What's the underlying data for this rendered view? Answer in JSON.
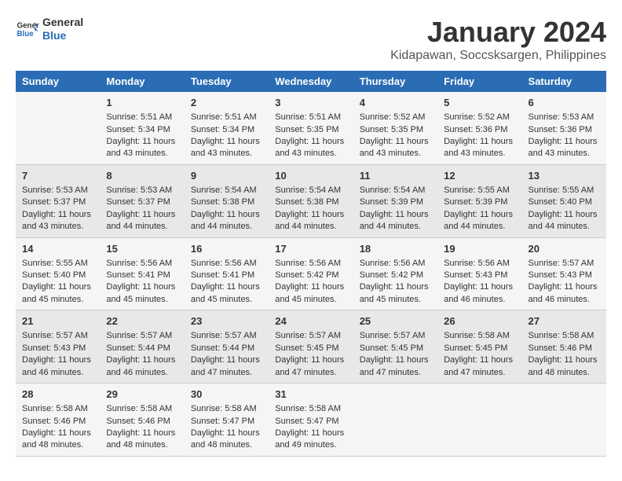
{
  "header": {
    "logo_line1": "General",
    "logo_line2": "Blue",
    "main_title": "January 2024",
    "subtitle": "Kidapawan, Soccsksargen, Philippines"
  },
  "calendar": {
    "days_of_week": [
      "Sunday",
      "Monday",
      "Tuesday",
      "Wednesday",
      "Thursday",
      "Friday",
      "Saturday"
    ],
    "weeks": [
      [
        {
          "day": "",
          "sunrise": "",
          "sunset": "",
          "daylight": ""
        },
        {
          "day": "1",
          "sunrise": "Sunrise: 5:51 AM",
          "sunset": "Sunset: 5:34 PM",
          "daylight": "Daylight: 11 hours and 43 minutes."
        },
        {
          "day": "2",
          "sunrise": "Sunrise: 5:51 AM",
          "sunset": "Sunset: 5:34 PM",
          "daylight": "Daylight: 11 hours and 43 minutes."
        },
        {
          "day": "3",
          "sunrise": "Sunrise: 5:51 AM",
          "sunset": "Sunset: 5:35 PM",
          "daylight": "Daylight: 11 hours and 43 minutes."
        },
        {
          "day": "4",
          "sunrise": "Sunrise: 5:52 AM",
          "sunset": "Sunset: 5:35 PM",
          "daylight": "Daylight: 11 hours and 43 minutes."
        },
        {
          "day": "5",
          "sunrise": "Sunrise: 5:52 AM",
          "sunset": "Sunset: 5:36 PM",
          "daylight": "Daylight: 11 hours and 43 minutes."
        },
        {
          "day": "6",
          "sunrise": "Sunrise: 5:53 AM",
          "sunset": "Sunset: 5:36 PM",
          "daylight": "Daylight: 11 hours and 43 minutes."
        }
      ],
      [
        {
          "day": "7",
          "sunrise": "Sunrise: 5:53 AM",
          "sunset": "Sunset: 5:37 PM",
          "daylight": "Daylight: 11 hours and 43 minutes."
        },
        {
          "day": "8",
          "sunrise": "Sunrise: 5:53 AM",
          "sunset": "Sunset: 5:37 PM",
          "daylight": "Daylight: 11 hours and 44 minutes."
        },
        {
          "day": "9",
          "sunrise": "Sunrise: 5:54 AM",
          "sunset": "Sunset: 5:38 PM",
          "daylight": "Daylight: 11 hours and 44 minutes."
        },
        {
          "day": "10",
          "sunrise": "Sunrise: 5:54 AM",
          "sunset": "Sunset: 5:38 PM",
          "daylight": "Daylight: 11 hours and 44 minutes."
        },
        {
          "day": "11",
          "sunrise": "Sunrise: 5:54 AM",
          "sunset": "Sunset: 5:39 PM",
          "daylight": "Daylight: 11 hours and 44 minutes."
        },
        {
          "day": "12",
          "sunrise": "Sunrise: 5:55 AM",
          "sunset": "Sunset: 5:39 PM",
          "daylight": "Daylight: 11 hours and 44 minutes."
        },
        {
          "day": "13",
          "sunrise": "Sunrise: 5:55 AM",
          "sunset": "Sunset: 5:40 PM",
          "daylight": "Daylight: 11 hours and 44 minutes."
        }
      ],
      [
        {
          "day": "14",
          "sunrise": "Sunrise: 5:55 AM",
          "sunset": "Sunset: 5:40 PM",
          "daylight": "Daylight: 11 hours and 45 minutes."
        },
        {
          "day": "15",
          "sunrise": "Sunrise: 5:56 AM",
          "sunset": "Sunset: 5:41 PM",
          "daylight": "Daylight: 11 hours and 45 minutes."
        },
        {
          "day": "16",
          "sunrise": "Sunrise: 5:56 AM",
          "sunset": "Sunset: 5:41 PM",
          "daylight": "Daylight: 11 hours and 45 minutes."
        },
        {
          "day": "17",
          "sunrise": "Sunrise: 5:56 AM",
          "sunset": "Sunset: 5:42 PM",
          "daylight": "Daylight: 11 hours and 45 minutes."
        },
        {
          "day": "18",
          "sunrise": "Sunrise: 5:56 AM",
          "sunset": "Sunset: 5:42 PM",
          "daylight": "Daylight: 11 hours and 45 minutes."
        },
        {
          "day": "19",
          "sunrise": "Sunrise: 5:56 AM",
          "sunset": "Sunset: 5:43 PM",
          "daylight": "Daylight: 11 hours and 46 minutes."
        },
        {
          "day": "20",
          "sunrise": "Sunrise: 5:57 AM",
          "sunset": "Sunset: 5:43 PM",
          "daylight": "Daylight: 11 hours and 46 minutes."
        }
      ],
      [
        {
          "day": "21",
          "sunrise": "Sunrise: 5:57 AM",
          "sunset": "Sunset: 5:43 PM",
          "daylight": "Daylight: 11 hours and 46 minutes."
        },
        {
          "day": "22",
          "sunrise": "Sunrise: 5:57 AM",
          "sunset": "Sunset: 5:44 PM",
          "daylight": "Daylight: 11 hours and 46 minutes."
        },
        {
          "day": "23",
          "sunrise": "Sunrise: 5:57 AM",
          "sunset": "Sunset: 5:44 PM",
          "daylight": "Daylight: 11 hours and 47 minutes."
        },
        {
          "day": "24",
          "sunrise": "Sunrise: 5:57 AM",
          "sunset": "Sunset: 5:45 PM",
          "daylight": "Daylight: 11 hours and 47 minutes."
        },
        {
          "day": "25",
          "sunrise": "Sunrise: 5:57 AM",
          "sunset": "Sunset: 5:45 PM",
          "daylight": "Daylight: 11 hours and 47 minutes."
        },
        {
          "day": "26",
          "sunrise": "Sunrise: 5:58 AM",
          "sunset": "Sunset: 5:45 PM",
          "daylight": "Daylight: 11 hours and 47 minutes."
        },
        {
          "day": "27",
          "sunrise": "Sunrise: 5:58 AM",
          "sunset": "Sunset: 5:46 PM",
          "daylight": "Daylight: 11 hours and 48 minutes."
        }
      ],
      [
        {
          "day": "28",
          "sunrise": "Sunrise: 5:58 AM",
          "sunset": "Sunset: 5:46 PM",
          "daylight": "Daylight: 11 hours and 48 minutes."
        },
        {
          "day": "29",
          "sunrise": "Sunrise: 5:58 AM",
          "sunset": "Sunset: 5:46 PM",
          "daylight": "Daylight: 11 hours and 48 minutes."
        },
        {
          "day": "30",
          "sunrise": "Sunrise: 5:58 AM",
          "sunset": "Sunset: 5:47 PM",
          "daylight": "Daylight: 11 hours and 48 minutes."
        },
        {
          "day": "31",
          "sunrise": "Sunrise: 5:58 AM",
          "sunset": "Sunset: 5:47 PM",
          "daylight": "Daylight: 11 hours and 49 minutes."
        },
        {
          "day": "",
          "sunrise": "",
          "sunset": "",
          "daylight": ""
        },
        {
          "day": "",
          "sunrise": "",
          "sunset": "",
          "daylight": ""
        },
        {
          "day": "",
          "sunrise": "",
          "sunset": "",
          "daylight": ""
        }
      ]
    ]
  }
}
